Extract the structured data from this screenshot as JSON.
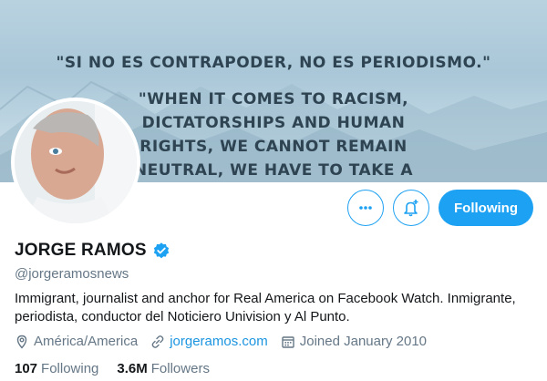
{
  "banner": {
    "quote_line_1": "\"SI NO ES CONTRAPODER, NO ES PERIODISMO.\"",
    "quote_line_2": "\"WHEN IT COMES TO RACISM, DICTATORSHIPS AND HUMAN RIGHTS, WE CANNOT REMAIN NEUTRAL, WE HAVE TO TAKE A STAND.\""
  },
  "actions": {
    "more_icon": "more-horizontal-icon",
    "notify_icon": "bell-plus-icon",
    "follow_label": "Following"
  },
  "profile": {
    "name": "JORGE RAMOS",
    "verified_icon": "verified-badge-icon",
    "handle": "@jorgeramosnews",
    "bio": "Immigrant, journalist and anchor for Real America on Facebook Watch. Inmigrante, periodista, conductor del Noticiero Univision y Al Punto."
  },
  "meta": {
    "location": "América/America",
    "website": "jorgeramos.com",
    "joined": "Joined January 2010"
  },
  "stats": {
    "following_count": "107",
    "following_label": "Following",
    "followers_count": "3.6M",
    "followers_label": "Followers"
  },
  "colors": {
    "accent": "#1da1f2",
    "secondary_text": "#657786",
    "link": "#1b95e0"
  }
}
